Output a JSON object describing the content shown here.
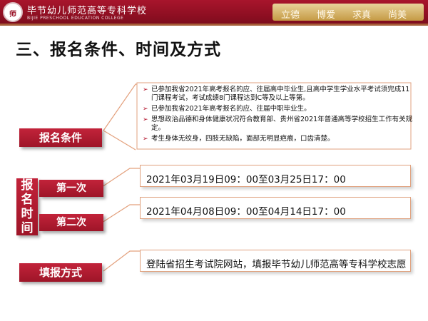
{
  "header": {
    "logo_text": "师",
    "school_name": "毕节幼儿师范高等专科学校",
    "school_name_en": "BIJIE PRESCHOOL EDUCATION COLLEGE",
    "motto": [
      "立德",
      "博爱",
      "求真",
      "尚美"
    ]
  },
  "page_title": "三、报名条件、时间及方式",
  "sections": {
    "conditions": {
      "label": "报名条件",
      "items": [
        "已参加我省2021年高考报名的应、往届高中毕业生,且高中学生学业水平考试须完成11门课程考试，考试成绩8门课程达到C等及以上等第。",
        "已参加我省2021年高考报名的应、往届中职毕业生。",
        "思想政治品德和身体健康状况符合教育部、贵州省2021年普通高等学校招生工作有关规定。",
        "考生身体无纹身，四肢无缺陷，面部无明显疤痕，口齿清楚。"
      ]
    },
    "time": {
      "label_chars": [
        "报",
        "名",
        "时",
        "间"
      ],
      "rounds": [
        {
          "label": "第一次",
          "period": "2021年03月19日09：00至03月25日17：00"
        },
        {
          "label": "第二次",
          "period": "2021年04月08日09：00至04月14日17：00"
        }
      ]
    },
    "method": {
      "label": "填报方式",
      "text": "登陆省招生考试院网站，填报毕节幼儿师范高等专科学校志愿"
    }
  },
  "colors": {
    "brand_red": "#a8152c",
    "accent_gold": "#c59a44",
    "box_border": "#e0a27f"
  }
}
